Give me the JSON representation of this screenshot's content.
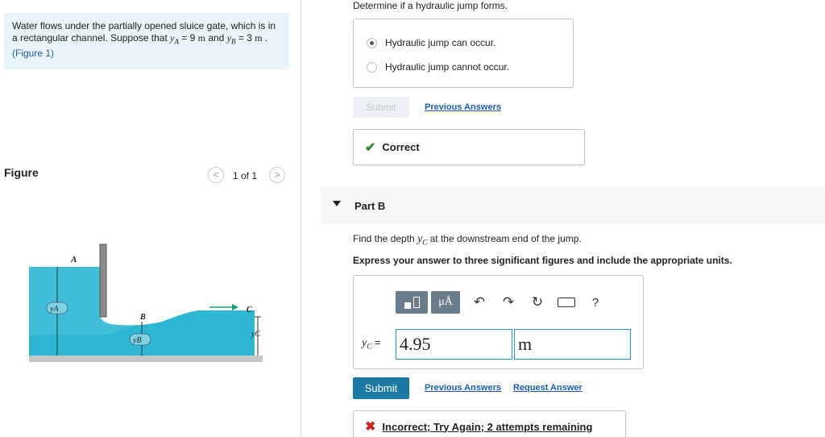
{
  "problem": {
    "text_1": "Water flows under the partially opened sluice gate, which is in a rectangular channel. Suppose that ",
    "ya_sym": "y",
    "ya_sub": "A",
    "ya_eq": " = 9 ",
    "ya_unit": "m",
    "and": " and ",
    "yb_sym": "y",
    "yb_sub": "B",
    "yb_eq": " = 3 ",
    "yb_unit": "m",
    "sep": " . ",
    "figure_link": "(Figure 1)"
  },
  "figure_panel": {
    "title": "Figure",
    "pager_label": "1 of 1",
    "prev_glyph": "<",
    "next_glyph": ">",
    "labels": {
      "A": "A",
      "B": "B",
      "C": "C",
      "yA": "yA",
      "yB": "yB",
      "yC": "yC"
    }
  },
  "partA": {
    "prompt": "Determine if a hydraulic jump forms.",
    "options": [
      {
        "label": "Hydraulic jump can occur.",
        "selected": true
      },
      {
        "label": "Hydraulic jump cannot occur.",
        "selected": false
      }
    ],
    "submit_label": "Submit",
    "previous_answers": "Previous Answers",
    "feedback": "Correct"
  },
  "partB": {
    "title": "Part B",
    "question_1": "Find the depth ",
    "question_sym": "y",
    "question_sub": "C",
    "question_2": " at the downstream end of the jump.",
    "instruction": "Express your answer to three significant figures and include the appropriate units.",
    "toolbar": {
      "units_glyph": "μÅ",
      "undo_icon": "undo-icon",
      "redo_icon": "redo-icon",
      "reset_icon": "reset-icon",
      "keyboard_icon": "keyboard-icon",
      "help_glyph": "?"
    },
    "answer_sym": "y",
    "answer_sub": "C",
    "answer_eq": " =",
    "answer_value": "4.95",
    "answer_unit": "m",
    "submit_label": "Submit",
    "previous_answers": "Previous Answers",
    "request_answer": "Request Answer",
    "feedback": "Incorrect; Try Again; 2 attempts remaining"
  },
  "colors": {
    "problem_bg": "#e9f3f8",
    "link": "#1c5fa8",
    "water": "#2fb6d3",
    "correct": "#2e8b2e",
    "incorrect": "#c62828",
    "submit_active": "#1b7aa3",
    "input_border": "#2e8fc6"
  }
}
